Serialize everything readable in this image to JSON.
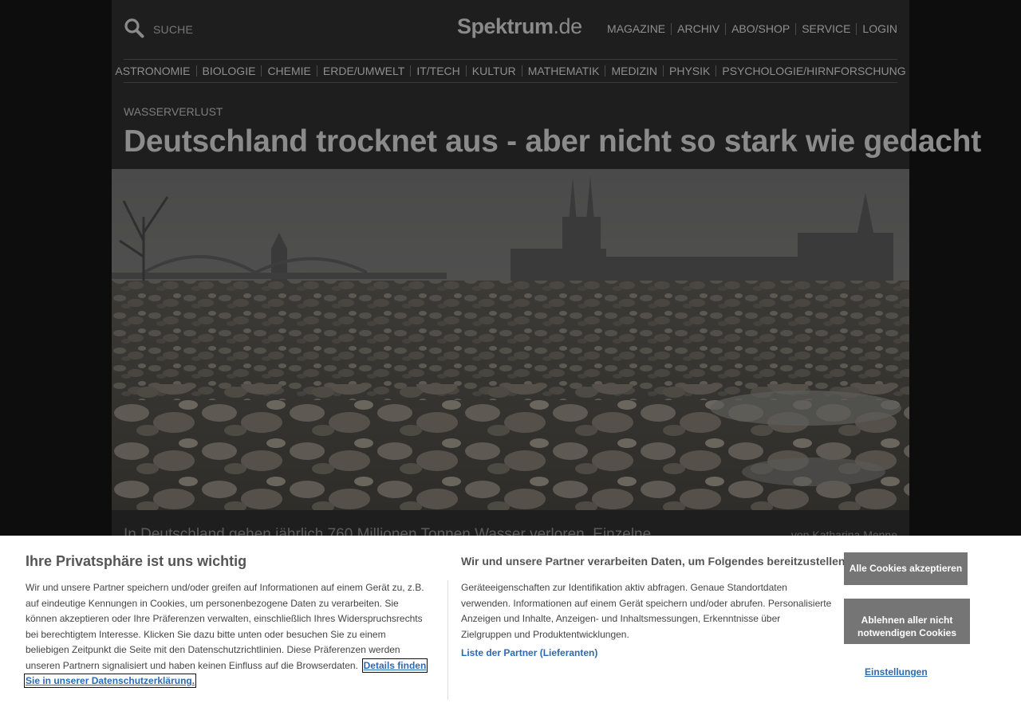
{
  "header": {
    "search_label": "SUCHE",
    "logo_main": "Spektrum",
    "logo_domain": ".de",
    "top_nav": [
      "MAGAZINE",
      "ARCHIV",
      "ABO/SHOP",
      "SERVICE",
      "LOGIN"
    ]
  },
  "categories": [
    "ASTRONOMIE",
    "BIOLOGIE",
    "CHEMIE",
    "ERDE/UMWELT",
    "IT/TECH",
    "KULTUR",
    "MATHEMATIK",
    "MEDIZIN",
    "PHYSIK",
    "PSYCHOLOGIE/HIRNFORSCHUNG"
  ],
  "article": {
    "kicker": "WASSERVERLUST",
    "headline": "Deutschland trocknet aus - aber nicht so stark wie gedacht",
    "teaser": "In Deutschland gehen jährlich 760 Millionen Tonnen Wasser verloren. Einzelne",
    "byline": "von Katharina Menne"
  },
  "consent": {
    "title": "Ihre Privatsphäre ist uns wichtig",
    "body": "Wir und unsere Partner speichern und/oder greifen auf Informationen auf einem Gerät zu, z.B. auf eindeutige Kennungen in Cookies, um personenbezogene Daten zu verarbeiten. Sie können akzeptieren oder Ihre Präferenzen verwalten, einschließlich Ihres Widerspruchsrechts bei berechtigtem Interesse. Klicken Sie dazu bitte unten oder besuchen Sie zu einem beliebigen Zeitpunkt die Seite mit den Datenschutzrichtlinien. Diese Präferenzen werden unseren Partnern signalisiert und haben keinen Einfluss auf die Browserdaten.",
    "privacy_link": "Details finden Sie in unserer Datenschutzerklärung.",
    "purposes_title": "Wir und unsere Partner verarbeiten Daten, um Folgendes bereitzustellen:",
    "purposes_body": "Geräteeigenschaften zur Identifikation aktiv abfragen. Genaue Standortdaten verwenden. Informationen auf einem Gerät speichern und/oder abrufen. Personalisierte Anzeigen und Inhalte, Anzeigen- und Inhaltsmessungen, Erkenntnisse über Zielgruppen und Produktentwicklungen.",
    "partners_link": "Liste der Partner (Lieferanten)",
    "accept_all": "Alle Cookies akzeptieren",
    "reject": "Ablehnen aller nicht notwendigen Cookies",
    "settings": "Einstellungen"
  },
  "icons": {
    "search": "search-icon"
  }
}
